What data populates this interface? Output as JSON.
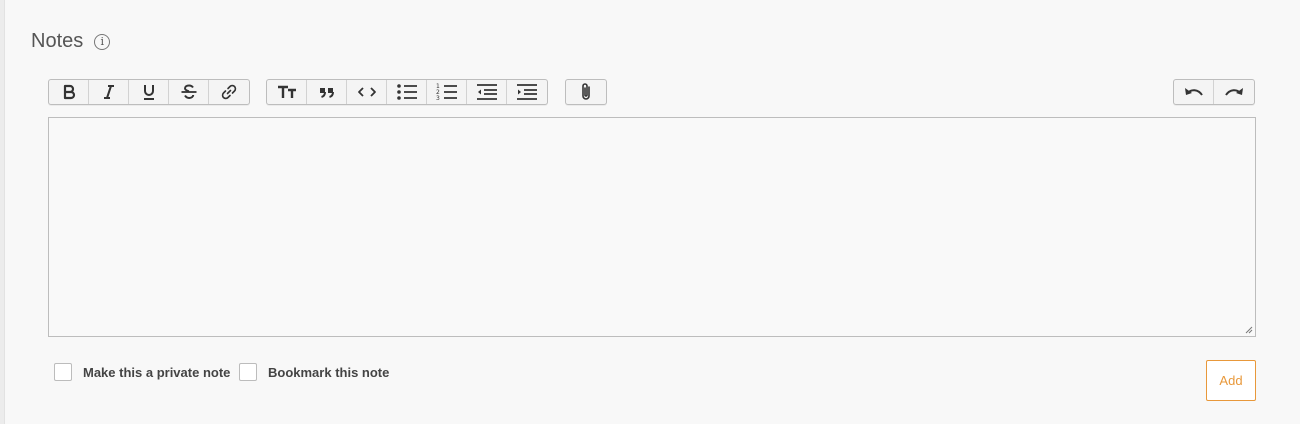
{
  "notes": {
    "title": "Notes",
    "info_glyph": "i"
  },
  "toolbar": {
    "groups": [
      [
        "bold-icon",
        "italic-icon",
        "underline-icon",
        "strikethrough-icon",
        "link-icon"
      ],
      [
        "heading-icon",
        "quote-icon",
        "code-icon",
        "bullet-list-icon",
        "numbered-list-icon",
        "outdent-icon",
        "indent-icon"
      ],
      [
        "attachment-icon"
      ],
      [
        "undo-icon",
        "redo-icon"
      ]
    ]
  },
  "editor": {
    "value": ""
  },
  "options": {
    "private_label": "Make this a private note",
    "private_checked": false,
    "bookmark_label": "Bookmark this note",
    "bookmark_checked": false
  },
  "add_button": {
    "label": "Add"
  },
  "colors": {
    "accent": "#e8983a",
    "background": "#f8f8f8",
    "border": "#bdbdbd"
  }
}
